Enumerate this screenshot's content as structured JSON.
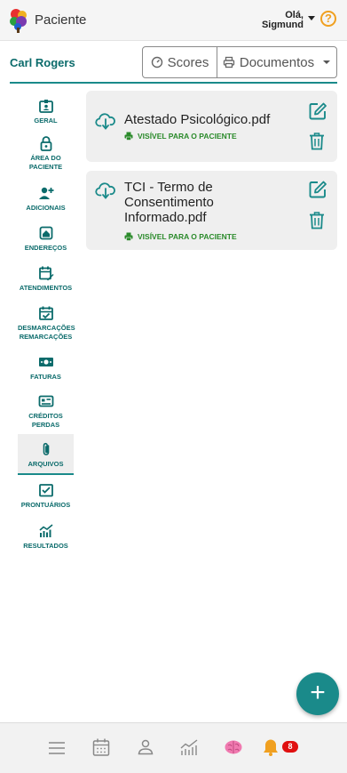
{
  "header": {
    "app_title": "Paciente",
    "greeting_line1": "Olá,",
    "greeting_line2": "Sigmund",
    "help_symbol": "?",
    "accent_color": "#f0a020"
  },
  "patient": {
    "name": "Carl Rogers"
  },
  "actions": {
    "scores_label": "Scores",
    "documents_label": "Documentos"
  },
  "sidebar": {
    "items": [
      {
        "label": "GERAL",
        "icon": "id-card-icon"
      },
      {
        "label": "ÁREA DO PACIENTE",
        "icon": "lock-icon"
      },
      {
        "label": "ADICIONAIS",
        "icon": "user-plus-icon"
      },
      {
        "label": "ENDEREÇOS",
        "icon": "home-icon"
      },
      {
        "label": "ATENDIMENTOS",
        "icon": "calendar-edit-icon"
      },
      {
        "label": "DESMARCAÇÕES REMARCAÇÕES",
        "icon": "calendar-check-icon"
      },
      {
        "label": "FATURAS",
        "icon": "money-icon"
      },
      {
        "label": "CRÉDITOS PERDAS",
        "icon": "credit-card-icon"
      },
      {
        "label": "ARQUIVOS",
        "icon": "paperclip-icon",
        "active": true
      },
      {
        "label": "PRONTUÁRIOS",
        "icon": "clipboard-check-icon"
      },
      {
        "label": "RESULTADOS",
        "icon": "chart-icon"
      }
    ]
  },
  "files": [
    {
      "name": "Atestado Psicológico.pdf",
      "visibility": "VISÍVEL PARA O PACIENTE"
    },
    {
      "name": "TCI - Termo de Consentimento Informado.pdf",
      "visibility": "VISÍVEL PARA O PACIENTE"
    }
  ],
  "fab": {
    "symbol": "+"
  },
  "bottom_nav": {
    "items": [
      "menu-icon",
      "calendar-icon",
      "person-icon",
      "chart-line-icon",
      "brain-icon",
      "bell-icon"
    ],
    "notification_count": "8"
  },
  "colors": {
    "primary": "#1a8a8a",
    "primary_dark": "#0b6b6b",
    "visible_green": "#2a8a2a",
    "badge_red": "#e01010"
  }
}
